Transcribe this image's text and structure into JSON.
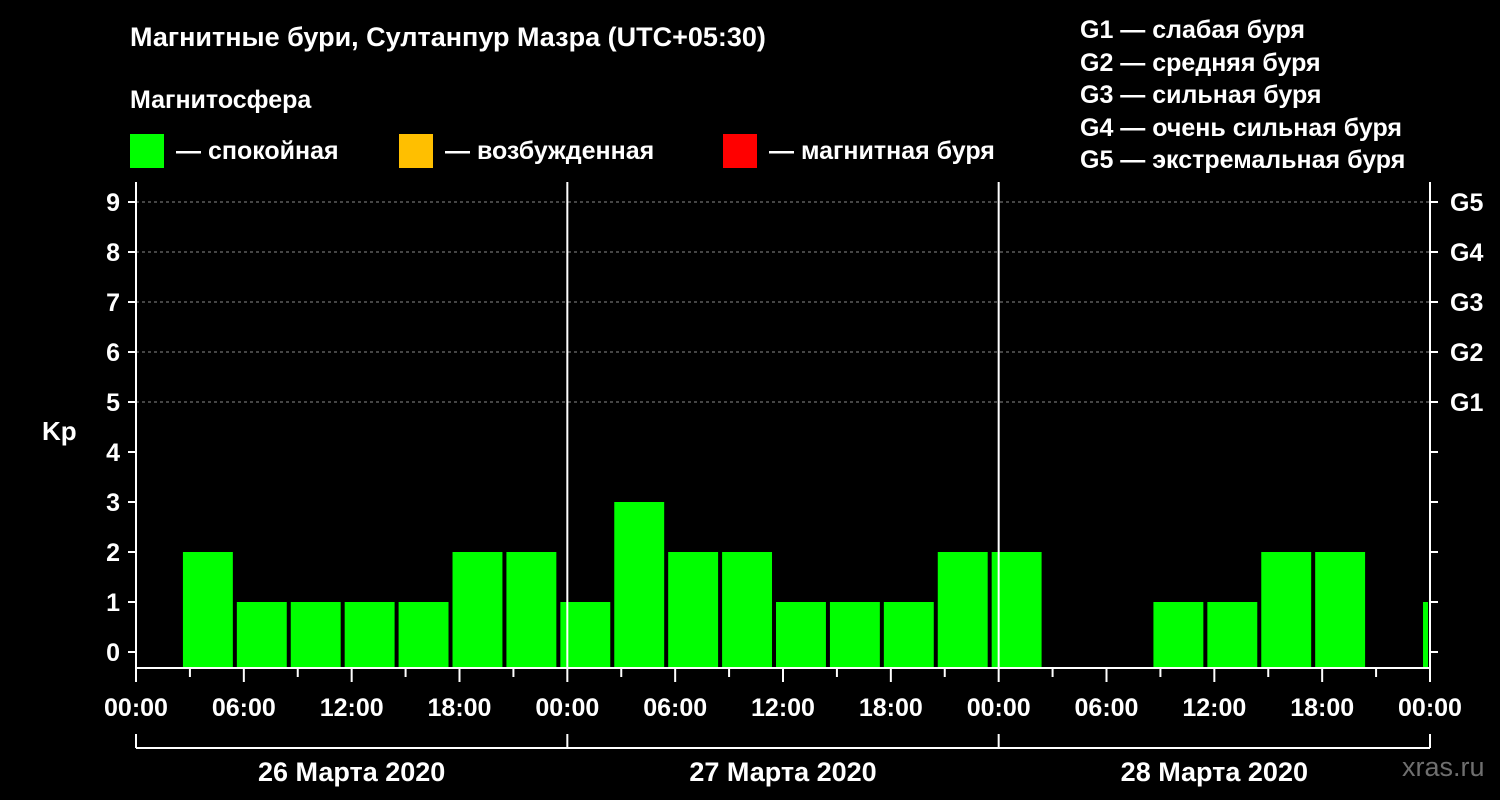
{
  "header": {
    "title": "Магнитные бури, Султанпур Мазра (UTC+05:30)",
    "subtitle": "Магнитосфера"
  },
  "legend": [
    {
      "label": "— спокойная",
      "color": "#00ff00"
    },
    {
      "label": "— возбужденная",
      "color": "#ffbf00"
    },
    {
      "label": "— магнитная буря",
      "color": "#ff0000"
    }
  ],
  "g_legend": [
    "G1 — слабая буря",
    "G2 — средняя буря",
    "G3 — сильная буря",
    "G4 — очень сильная буря",
    "G5 — экстремальная буря"
  ],
  "watermark": "xras.ru",
  "chart_data": {
    "type": "bar",
    "ylabel": "Kp",
    "ylim": [
      0,
      9
    ],
    "y_ticks": [
      0,
      1,
      2,
      3,
      4,
      5,
      6,
      7,
      8,
      9
    ],
    "right_axis_labels": [
      {
        "kp": 5,
        "label": "G1"
      },
      {
        "kp": 6,
        "label": "G2"
      },
      {
        "kp": 7,
        "label": "G3"
      },
      {
        "kp": 8,
        "label": "G4"
      },
      {
        "kp": 9,
        "label": "G5"
      }
    ],
    "x_tick_labels": [
      "00:00",
      "06:00",
      "12:00",
      "18:00",
      "00:00",
      "06:00",
      "12:00",
      "18:00",
      "00:00",
      "06:00",
      "12:00",
      "18:00",
      "00:00"
    ],
    "days": [
      "26 Марта 2020",
      "27 Марта 2020",
      "28 Марта 2020"
    ],
    "color": "#00ff00",
    "grid_y_dashed": [
      5,
      6,
      7,
      8,
      9
    ],
    "bars": [
      {
        "start": "2020-03-26 02:30",
        "end": "2020-03-26 05:30",
        "kp": 2
      },
      {
        "start": "2020-03-26 05:30",
        "end": "2020-03-26 08:30",
        "kp": 1
      },
      {
        "start": "2020-03-26 08:30",
        "end": "2020-03-26 11:30",
        "kp": 1
      },
      {
        "start": "2020-03-26 11:30",
        "end": "2020-03-26 14:30",
        "kp": 1
      },
      {
        "start": "2020-03-26 14:30",
        "end": "2020-03-26 17:30",
        "kp": 1
      },
      {
        "start": "2020-03-26 17:30",
        "end": "2020-03-26 20:30",
        "kp": 2
      },
      {
        "start": "2020-03-26 20:30",
        "end": "2020-03-26 23:30",
        "kp": 2
      },
      {
        "start": "2020-03-26 23:30",
        "end": "2020-03-27 02:30",
        "kp": 1
      },
      {
        "start": "2020-03-27 02:30",
        "end": "2020-03-27 05:30",
        "kp": 3
      },
      {
        "start": "2020-03-27 05:30",
        "end": "2020-03-27 08:30",
        "kp": 2
      },
      {
        "start": "2020-03-27 08:30",
        "end": "2020-03-27 11:30",
        "kp": 2
      },
      {
        "start": "2020-03-27 11:30",
        "end": "2020-03-27 14:30",
        "kp": 1
      },
      {
        "start": "2020-03-27 14:30",
        "end": "2020-03-27 17:30",
        "kp": 1
      },
      {
        "start": "2020-03-27 17:30",
        "end": "2020-03-27 20:30",
        "kp": 1
      },
      {
        "start": "2020-03-27 20:30",
        "end": "2020-03-27 23:30",
        "kp": 2
      },
      {
        "start": "2020-03-27 23:30",
        "end": "2020-03-28 02:30",
        "kp": 2
      },
      {
        "start": "2020-03-28 08:30",
        "end": "2020-03-28 11:30",
        "kp": 1
      },
      {
        "start": "2020-03-28 11:30",
        "end": "2020-03-28 14:30",
        "kp": 1
      },
      {
        "start": "2020-03-28 14:30",
        "end": "2020-03-28 17:30",
        "kp": 2
      },
      {
        "start": "2020-03-28 17:30",
        "end": "2020-03-28 20:30",
        "kp": 2
      },
      {
        "start": "2020-03-28 23:30",
        "end": "2020-03-29 02:30",
        "kp": 1
      }
    ]
  }
}
